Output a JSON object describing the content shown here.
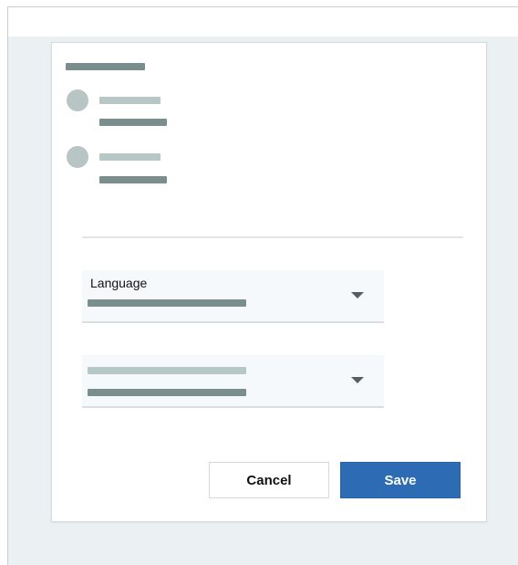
{
  "dialog": {
    "language_select": {
      "label": "Language"
    },
    "buttons": {
      "cancel_label": "Cancel",
      "save_label": "Save"
    }
  },
  "icons": {
    "user_avatar": "avatar",
    "dropdown": "chevron-down-icon"
  }
}
